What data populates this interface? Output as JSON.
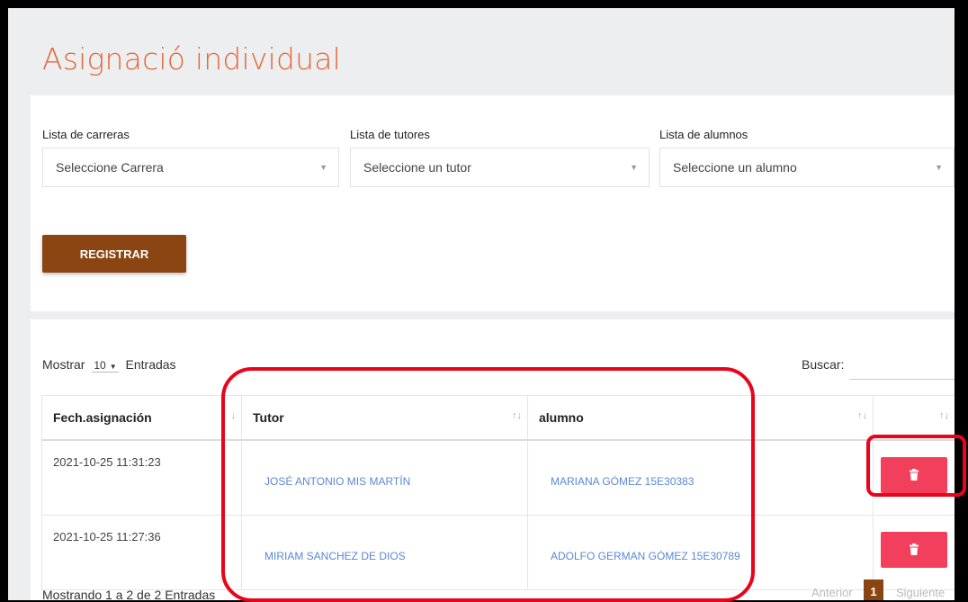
{
  "page": {
    "title": "Asignació individual"
  },
  "form": {
    "career": {
      "label": "Lista de carreras",
      "value": "Seleccione Carrera"
    },
    "tutor": {
      "label": "Lista de tutores",
      "value": "Seleccione un tutor"
    },
    "student": {
      "label": "Lista de alumnos",
      "value": "Seleccione un alumno"
    },
    "register_label": "REGISTRAR"
  },
  "table": {
    "show_label": "Mostrar",
    "page_length": "10",
    "entries_label": "Entradas",
    "search_label": "Buscar:",
    "headers": [
      "Fech.asignación",
      "Tutor",
      "alumno",
      ""
    ],
    "rows": [
      {
        "date": "2021-10-25 11:31:23",
        "tutor": "JOSÉ ANTONIO MIS MARTÍN",
        "student": "MARIANA GÓMEZ 15E30383"
      },
      {
        "date": "2021-10-25 11:27:36",
        "tutor": "MIRIAM SANCHEZ DE DIOS",
        "student": "ADOLFO GERMAN GÓMEZ 15E30789"
      }
    ],
    "info": "Mostrando 1 a 2 de 2 Entradas",
    "pagination": {
      "prev": "Anterior",
      "current": "1",
      "next": "Siguiente"
    }
  },
  "icons": {
    "delete": "trash-icon",
    "dropdown": "chevron-down-icon",
    "sort": "sort-icon"
  },
  "colors": {
    "title": "#e5673a",
    "primary": "#8b4513",
    "danger": "#f2405c",
    "link": "#5b88d6",
    "highlight": "#e8051c"
  }
}
